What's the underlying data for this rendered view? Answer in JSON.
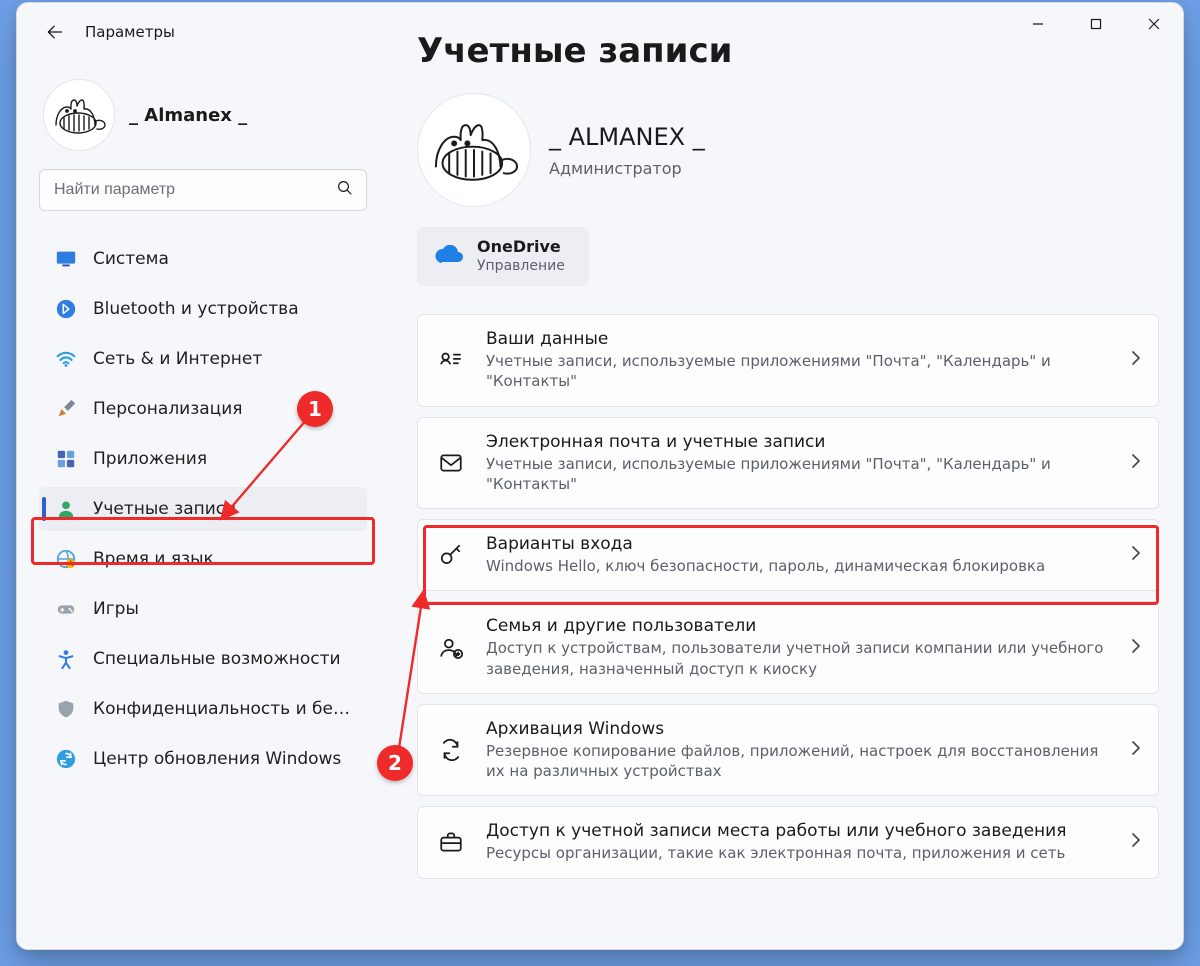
{
  "window": {
    "back_label": "Параметры",
    "page_title": "Учетные записи"
  },
  "sidebar_profile": {
    "name": "_ Almanex _"
  },
  "search": {
    "placeholder": "Найти параметр"
  },
  "nav": {
    "items": [
      {
        "label": "Система"
      },
      {
        "label": "Bluetooth и устройства"
      },
      {
        "label": "Сеть & и Интернет"
      },
      {
        "label": "Персонализация"
      },
      {
        "label": "Приложения"
      },
      {
        "label": "Учетные записи"
      },
      {
        "label": "Время и язык"
      },
      {
        "label": "Игры"
      },
      {
        "label": "Специальные возможности"
      },
      {
        "label": "Конфиденциальность и безопасность"
      },
      {
        "label": "Центр обновления Windows"
      }
    ],
    "selected_index": 5
  },
  "header_profile": {
    "name": "_ ALMANEX _",
    "role": "Администратор"
  },
  "onedrive": {
    "title": "OneDrive",
    "sub": "Управление"
  },
  "cards": [
    {
      "title": "Ваши данные",
      "sub": "Учетные записи, используемые приложениями \"Почта\", \"Календарь\" и \"Контакты\""
    },
    {
      "title": "Электронная почта и учетные записи",
      "sub": "Учетные записи, используемые приложениями \"Почта\", \"Календарь\" и \"Контакты\""
    },
    {
      "title": "Варианты входа",
      "sub": "Windows Hello, ключ безопасности, пароль, динамическая блокировка"
    },
    {
      "title": "Семья и другие пользователи",
      "sub": "Доступ к устройствам, пользователи учетной записи компании или учебного заведения, назначенный доступ к киоску"
    },
    {
      "title": "Архивация Windows",
      "sub": "Резервное копирование файлов, приложений, настроек для восстановления их на различных устройствах"
    },
    {
      "title": "Доступ к учетной записи места работы или учебного заведения",
      "sub": "Ресурсы организации, такие как электронная почта, приложения и сеть"
    }
  ],
  "annotations": {
    "badge1": "1",
    "badge2": "2"
  }
}
